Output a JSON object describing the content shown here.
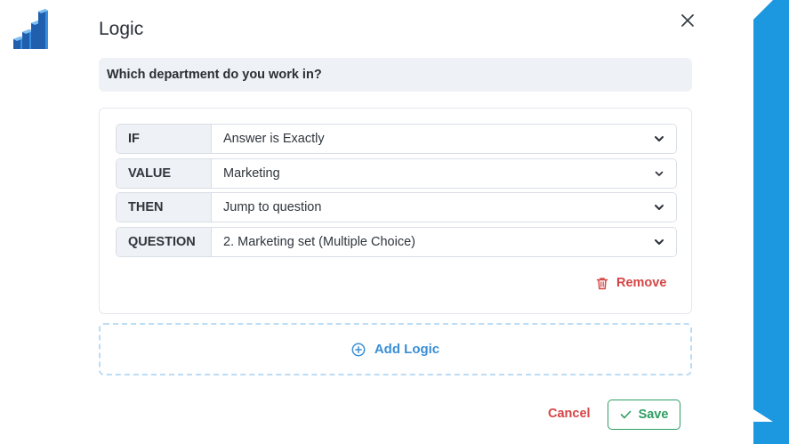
{
  "modal": {
    "title": "Logic",
    "question": "Which department do you work in?"
  },
  "rules": [
    {
      "label": "IF",
      "value": "Answer is Exactly"
    },
    {
      "label": "VALUE",
      "value": "Marketing"
    },
    {
      "label": "THEN",
      "value": "Jump to question"
    },
    {
      "label": "QUESTION",
      "value": "2. Marketing set (Multiple Choice)"
    }
  ],
  "actions": {
    "remove_label": "Remove",
    "add_logic_label": "Add Logic",
    "cancel_label": "Cancel",
    "save_label": "Save"
  },
  "icons": {
    "logo": "stairs-bar-logo-icon",
    "close": "close-icon",
    "dropdown": "chevron-down-icon",
    "remove": "trash-icon",
    "add": "plus-circle-icon",
    "save": "check-icon"
  },
  "colors": {
    "accent_blue": "#1b98e0",
    "danger": "#d64545",
    "success": "#2f9e63",
    "link_blue": "#3a8fd6"
  }
}
